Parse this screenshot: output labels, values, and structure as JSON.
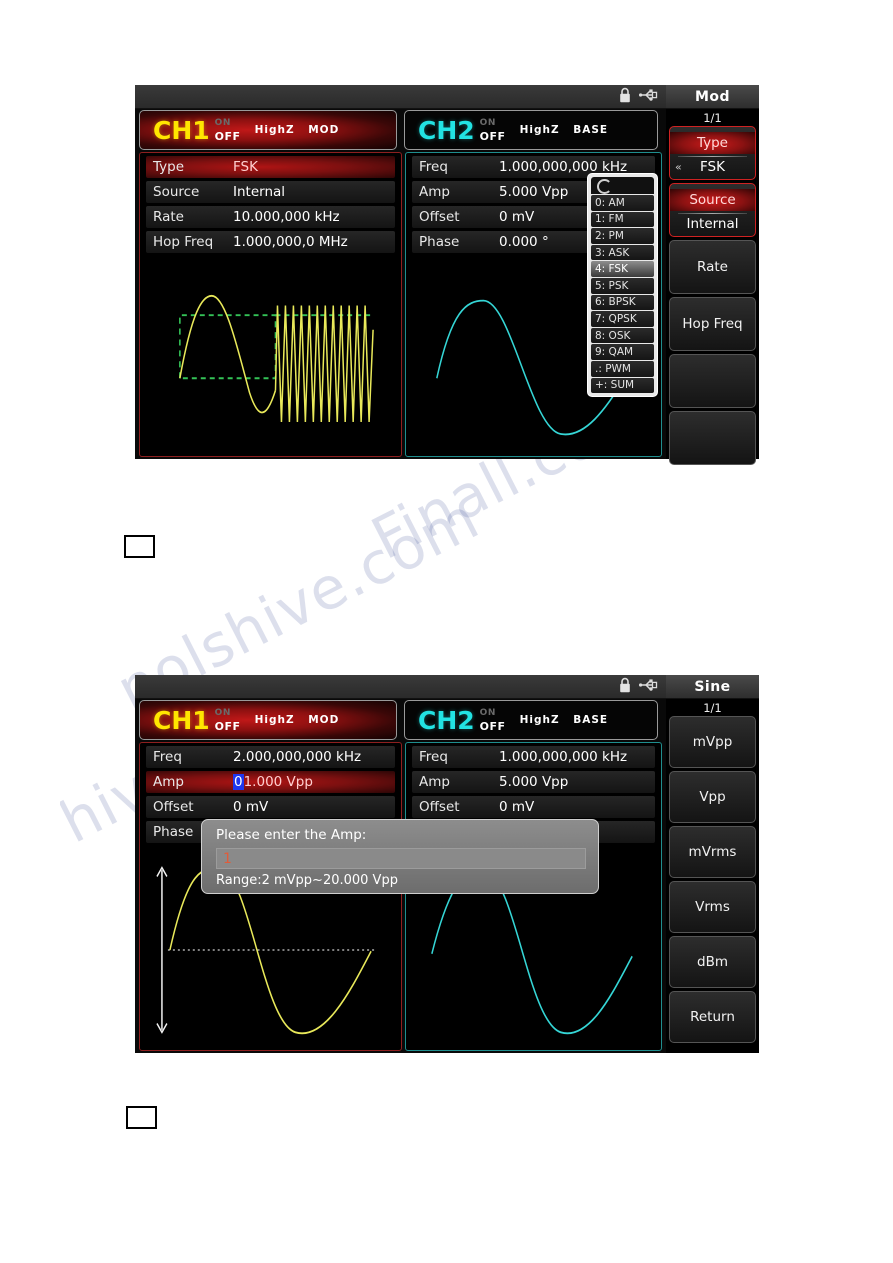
{
  "watermark": {
    "lines": [
      "Finall.com",
      "nolshive.com",
      "hive.com"
    ]
  },
  "screens": [
    {
      "id": "screen-mod-fsk",
      "statusbar": {
        "lock_icon": "lock-icon",
        "usb_icon": "usb-icon"
      },
      "channels": [
        {
          "name": "CH1",
          "on": "ON",
          "off": "OFF",
          "impedance": "HighZ",
          "mode": "MOD",
          "active": true
        },
        {
          "name": "CH2",
          "on": "ON",
          "off": "OFF",
          "impedance": "HighZ",
          "mode": "BASE",
          "active": false
        }
      ],
      "panel1": {
        "rows": [
          {
            "label": "Type",
            "value": "FSK",
            "selected": true
          },
          {
            "label": "Source",
            "value": "Internal",
            "selected": false
          },
          {
            "label": "Rate",
            "value": "10.000,000 kHz",
            "selected": false
          },
          {
            "label": "Hop Freq",
            "value": "1.000,000,0 MHz",
            "selected": false
          }
        ]
      },
      "panel2": {
        "rows": [
          {
            "label": "Freq",
            "value": "1.000,000,000 kHz",
            "selected": false
          },
          {
            "label": "Amp",
            "value": "5.000 Vpp",
            "selected": false
          },
          {
            "label": "Offset",
            "value": "0 mV",
            "selected": false
          },
          {
            "label": "Phase",
            "value": "0.000 °",
            "selected": false
          }
        ]
      },
      "dropdown": {
        "items": [
          {
            "text": "0: AM",
            "selected": false
          },
          {
            "text": "1: FM",
            "selected": false
          },
          {
            "text": "2: PM",
            "selected": false
          },
          {
            "text": "3: ASK",
            "selected": false
          },
          {
            "text": "4: FSK",
            "selected": true
          },
          {
            "text": "5: PSK",
            "selected": false
          },
          {
            "text": "6: BPSK",
            "selected": false
          },
          {
            "text": "7: QPSK",
            "selected": false
          },
          {
            "text": "8: OSK",
            "selected": false
          },
          {
            "text": "9: QAM",
            "selected": false
          },
          {
            "text": ".: PWM",
            "selected": false
          },
          {
            "text": "+: SUM",
            "selected": false
          }
        ]
      },
      "menu": {
        "title": "Mod",
        "page": "1/1",
        "keys": [
          {
            "top": "Type",
            "sub": "FSK",
            "highlight": true,
            "chevron": "«"
          },
          {
            "top": "Source",
            "sub": "Internal",
            "highlight": true,
            "chevron": ""
          },
          {
            "top": "Rate",
            "sub": "",
            "highlight": false,
            "chevron": ""
          },
          {
            "top": "Hop Freq",
            "sub": "",
            "highlight": false,
            "chevron": ""
          },
          {
            "top": "",
            "sub": "",
            "highlight": false,
            "chevron": ""
          },
          {
            "top": "",
            "sub": "",
            "highlight": false,
            "chevron": ""
          }
        ]
      }
    },
    {
      "id": "screen-sine-amp-entry",
      "statusbar": {
        "lock_icon": "lock-icon",
        "usb_icon": "usb-icon"
      },
      "channels": [
        {
          "name": "CH1",
          "on": "ON",
          "off": "OFF",
          "impedance": "HighZ",
          "mode": "MOD",
          "active": true
        },
        {
          "name": "CH2",
          "on": "ON",
          "off": "OFF",
          "impedance": "HighZ",
          "mode": "BASE",
          "active": false
        }
      ],
      "panel1": {
        "rows": [
          {
            "label": "Freq",
            "value": "2.000,000,000 kHz",
            "selected": false
          },
          {
            "label": "Amp",
            "value": "01.000 Vpp",
            "cursor_digit": "0",
            "rest": "1.000 Vpp",
            "selected": true
          },
          {
            "label": "Offset",
            "value": "0 mV",
            "selected": false
          },
          {
            "label": "Phase",
            "value": "",
            "selected": false
          }
        ]
      },
      "panel2": {
        "rows": [
          {
            "label": "Freq",
            "value": "1.000,000,000 kHz",
            "selected": false
          },
          {
            "label": "Amp",
            "value": "5.000 Vpp",
            "selected": false
          },
          {
            "label": "Offset",
            "value": "0 mV",
            "selected": false
          },
          {
            "label": "",
            "value": "",
            "selected": false
          }
        ]
      },
      "dialog": {
        "title": "Please enter the Amp:",
        "input_value": "1",
        "range": "Range:2 mVpp~20.000 Vpp"
      },
      "menu": {
        "title": "Sine",
        "page": "1/1",
        "keys": [
          {
            "top": "mVpp",
            "sub": "",
            "highlight": false,
            "chevron": ""
          },
          {
            "top": "Vpp",
            "sub": "",
            "highlight": false,
            "chevron": ""
          },
          {
            "top": "mVrms",
            "sub": "",
            "highlight": false,
            "chevron": ""
          },
          {
            "top": "Vrms",
            "sub": "",
            "highlight": false,
            "chevron": ""
          },
          {
            "top": "dBm",
            "sub": "",
            "highlight": false,
            "chevron": ""
          },
          {
            "top": "Return",
            "sub": "",
            "highlight": false,
            "chevron": ""
          }
        ]
      }
    }
  ],
  "colors": {
    "ch1_yellow": "#e9e95a",
    "ch2_cyan": "#35d6d6",
    "mod_green": "#34c257",
    "accent_red": "#cc1b1b",
    "cursor_blue": "#1f37ef"
  }
}
